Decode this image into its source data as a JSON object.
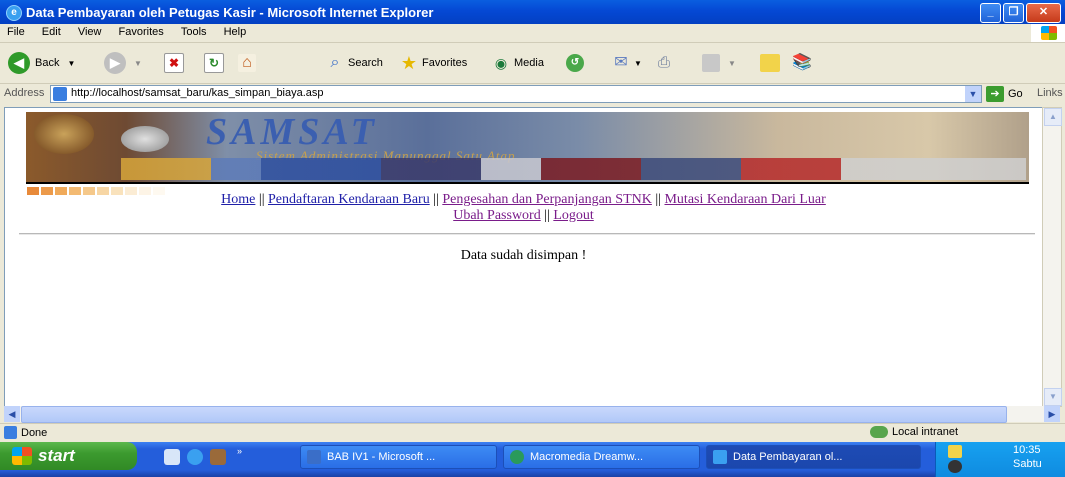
{
  "window": {
    "title": "Data Pembayaran oleh Petugas Kasir - Microsoft Internet Explorer",
    "minimize": "_",
    "maximize": "❐",
    "close": "✕"
  },
  "menu": [
    "File",
    "Edit",
    "View",
    "Favorites",
    "Tools",
    "Help"
  ],
  "toolbar": {
    "back": "Back",
    "search": "Search",
    "favorites": "Favorites",
    "media": "Media"
  },
  "address": {
    "label": "Address",
    "url": "http://localhost/samsat_baru/kas_simpan_biaya.asp",
    "go": "Go",
    "links": "Links"
  },
  "page": {
    "banner_title": "SAMSAT",
    "banner_subtitle": "Sistem Administrasi Manunggal Satu Atap",
    "nav_row1": [
      {
        "label": "Home",
        "visited": false
      },
      {
        "label": "Pendaftaran Kendaraan Baru",
        "visited": false
      },
      {
        "label": "Pengesahan dan Perpanjangan STNK",
        "visited": true
      },
      {
        "label": "Mutasi Kendaraan Dari Luar",
        "visited": true
      }
    ],
    "nav_row2": [
      {
        "label": "Ubah Password",
        "visited": true
      },
      {
        "label": "Logout",
        "visited": true
      }
    ],
    "separator": "||",
    "message": "Data sudah disimpan !"
  },
  "status": {
    "text": "Done",
    "zone": "Local intranet"
  },
  "taskbar": {
    "start": "start",
    "tasks": [
      {
        "label": "BAB IV1 - Microsoft ...",
        "active": false
      },
      {
        "label": "Macromedia Dreamw...",
        "active": false
      },
      {
        "label": "Data Pembayaran ol...",
        "active": true
      }
    ],
    "time": "10:35",
    "day": "Sabtu"
  },
  "colors": {
    "titlebar": "#0548d4",
    "link": "#1f1fa8",
    "visited_link": "#7a1c8a",
    "taskbar": "#245edb",
    "start": "#3c9a2f"
  }
}
